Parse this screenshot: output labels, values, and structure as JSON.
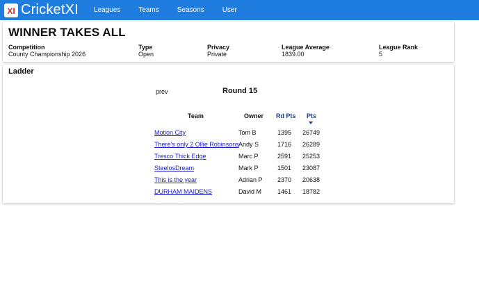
{
  "app": {
    "name": "CricketXI",
    "logo_letter": "XI",
    "colors": {
      "navbar": "#1f7de0",
      "link": "#1a1acc",
      "sort_header": "#1a3f86"
    }
  },
  "nav": {
    "items": [
      {
        "label": "Leagues"
      },
      {
        "label": "Teams"
      },
      {
        "label": "Seasons"
      },
      {
        "label": "User"
      }
    ]
  },
  "league": {
    "title": "WINNER TAKES ALL",
    "fields": [
      {
        "label": "Competition",
        "value": "County Championship 2026"
      },
      {
        "label": "Type",
        "value": "Open"
      },
      {
        "label": "Privacy",
        "value": "Private"
      },
      {
        "label": "League Average",
        "value": "1839.00"
      },
      {
        "label": "League Rank",
        "value": "5"
      }
    ]
  },
  "ladder": {
    "title": "Ladder",
    "prev_label": "prev",
    "round_label": "Round 15",
    "columns": [
      {
        "label": "Team"
      },
      {
        "label": "Owner"
      },
      {
        "label": "Rd Pts"
      },
      {
        "label": "Pts"
      }
    ],
    "sorted_column": "Pts",
    "rows": [
      {
        "team": "Motion City",
        "owner": "Tom B",
        "rd_pts": "1395",
        "pts": "26749"
      },
      {
        "team": "There's only 2 Ollie Robinsons",
        "owner": "Andy S",
        "rd_pts": "1716",
        "pts": "26289"
      },
      {
        "team": "Tresco Thick Edge",
        "owner": "Marc P",
        "rd_pts": "2591",
        "pts": "25253"
      },
      {
        "team": "SteelosDream",
        "owner": "Mark P",
        "rd_pts": "1501",
        "pts": "23087"
      },
      {
        "team": "This is the year",
        "owner": "Adrian P",
        "rd_pts": "2370",
        "pts": "20638"
      },
      {
        "team": "DURHAM MAIDENS",
        "owner": "David M",
        "rd_pts": "1461",
        "pts": "18782"
      }
    ]
  }
}
